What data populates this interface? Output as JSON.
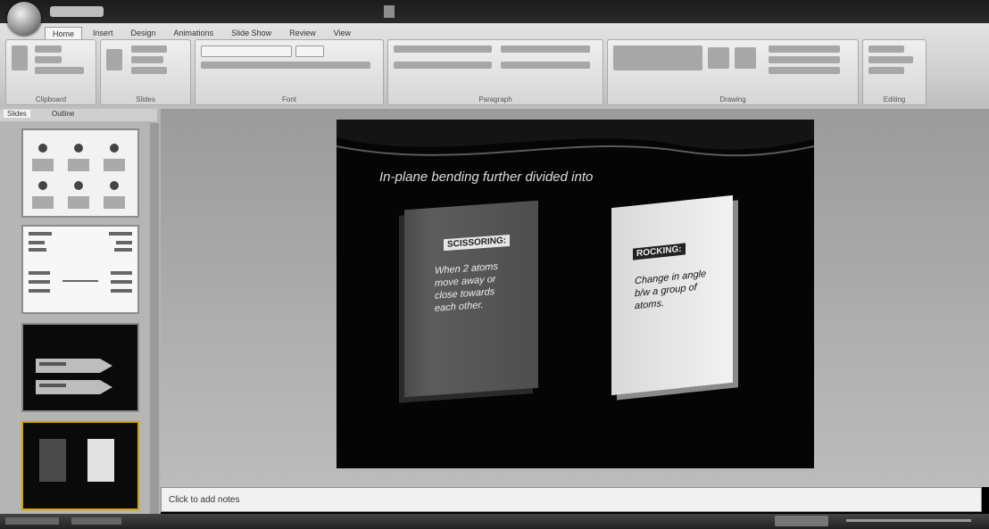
{
  "ribbon": {
    "tabs": [
      "Home",
      "Insert",
      "Design",
      "Animations",
      "Slide Show",
      "Review",
      "View"
    ],
    "active_tab": "Home",
    "groups": [
      "Clipboard",
      "Slides",
      "Font",
      "Paragraph",
      "Drawing",
      "Editing"
    ]
  },
  "left_panel": {
    "tabs": [
      "Slides",
      "Outline"
    ],
    "active_tab": "Slides"
  },
  "slide": {
    "title": "In-plane bending further divided into",
    "left_card": {
      "heading": "SCISSORING:",
      "body": "When 2 atoms move away or close towards each other."
    },
    "right_card": {
      "heading": "ROCKING:",
      "body": "Change in angle b/w a group of atoms."
    }
  },
  "notes": {
    "placeholder": "Click to add notes"
  },
  "colors": {
    "slide_background": "#050505",
    "ribbon": "#d6d6d6",
    "workspace": "#aaaaaa"
  }
}
